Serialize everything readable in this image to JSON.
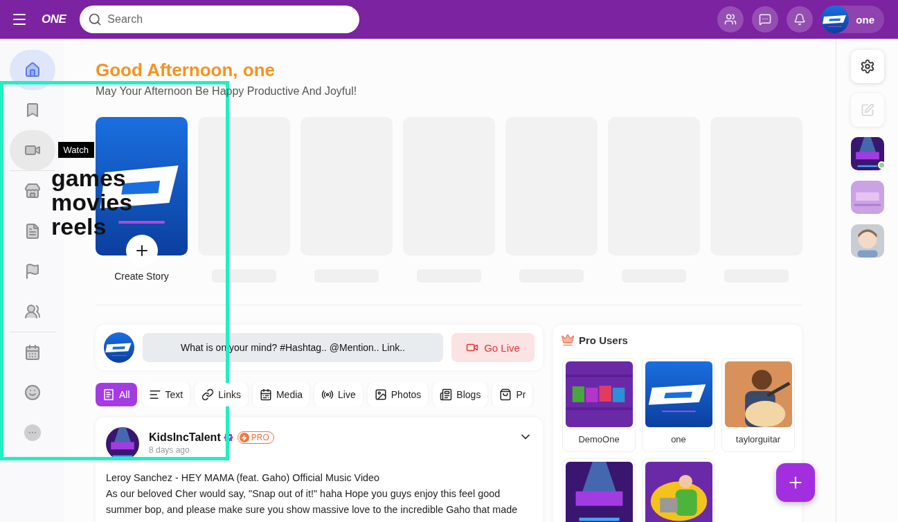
{
  "header": {
    "logo": "ONE",
    "search": {
      "placeholder": "Search"
    },
    "user": {
      "name": "one"
    }
  },
  "sidebar": {
    "groups": [
      [
        {
          "selected": true,
          "hovered": false
        },
        {
          "selected": false,
          "hovered": false
        },
        {
          "selected": false,
          "hovered": true,
          "tooltip": "Watch"
        }
      ],
      [
        {
          "selected": false,
          "hovered": false
        },
        {
          "selected": false,
          "hovered": false
        },
        {
          "selected": false,
          "hovered": false
        },
        {
          "selected": false,
          "hovered": false
        }
      ],
      [
        {
          "selected": false,
          "hovered": false
        },
        {
          "selected": false,
          "hovered": false
        },
        {
          "selected": false,
          "hovered": false
        }
      ]
    ]
  },
  "greeting": {
    "title": "Good Afternoon, one",
    "subtitle": "May Your Afternoon Be Happy Productive And Joyful!"
  },
  "stories": [
    {
      "kind": "create",
      "label": "Create Story"
    },
    {
      "kind": "skeleton"
    },
    {
      "kind": "skeleton"
    },
    {
      "kind": "skeleton"
    },
    {
      "kind": "skeleton"
    },
    {
      "kind": "skeleton"
    },
    {
      "kind": "skeleton"
    }
  ],
  "composer": {
    "placeholder": "What is on your mind? #Hashtag.. @Mention.. Link..",
    "live_button": "Go Live"
  },
  "filters": [
    {
      "label": "All",
      "selected": true
    },
    {
      "label": "Text",
      "selected": false
    },
    {
      "label": "Links",
      "selected": false
    },
    {
      "label": "Media",
      "selected": false
    },
    {
      "label": "Live",
      "selected": false
    },
    {
      "label": "Photos",
      "selected": false
    },
    {
      "label": "Blogs",
      "selected": false
    },
    {
      "label": "Pr",
      "selected": false
    }
  ],
  "post": {
    "author": "KidsIncTalent",
    "verified": true,
    "badge": "PRO",
    "time": "8 days ago",
    "title": "Leroy Sanchez - HEY MAMA (feat. Gaho) Official Music Video",
    "body": "As our beloved Cher would say, \"Snap out of it!\" haha Hope you guys enjoy this feel good summer bop, and please make sure you show massive love to the incredible Gaho that made"
  },
  "pro_users": {
    "title": "Pro Users",
    "users": [
      {
        "kind": "named",
        "name": "DemoOne"
      },
      {
        "kind": "named",
        "name": "one"
      },
      {
        "kind": "named",
        "name": "taylorguitar"
      },
      {
        "kind": "picture"
      },
      {
        "kind": "picture"
      }
    ]
  },
  "right_rail": {
    "contacts": [
      {
        "online": true
      },
      {
        "online": false
      },
      {
        "online": false
      }
    ]
  },
  "overlay": {
    "lines": [
      "games",
      "movies",
      "reels"
    ]
  }
}
